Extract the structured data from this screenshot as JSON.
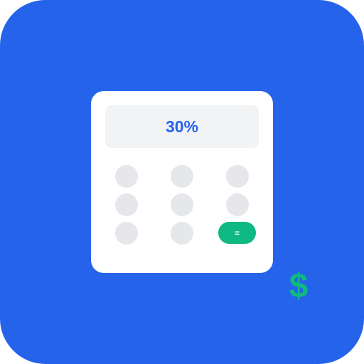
{
  "colors": {
    "background": "#2563eb",
    "card": "#ffffff",
    "display_bg": "#f2f3f5",
    "display_text": "#2563eb",
    "key": "#e5e7eb",
    "accent": "#10b981"
  },
  "calculator": {
    "display_value": "30%",
    "equals_label": "="
  },
  "icons": {
    "currency": "dollar-sign-icon",
    "currency_glyph": "$"
  }
}
